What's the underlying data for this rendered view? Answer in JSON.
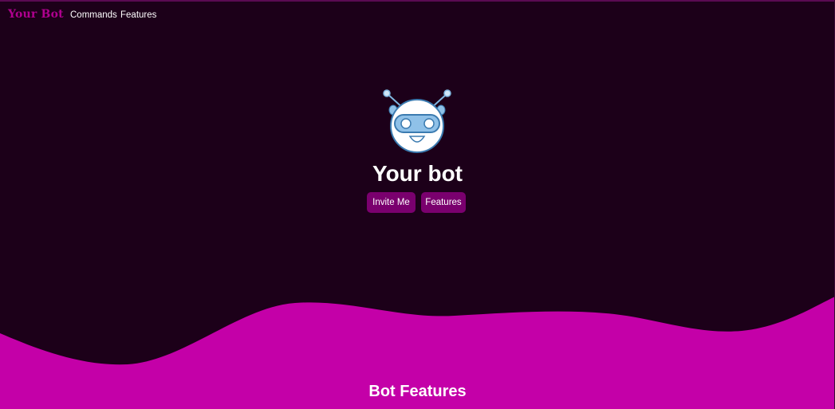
{
  "navbar": {
    "brand": "Your Bot",
    "links": [
      {
        "label": "Commands"
      },
      {
        "label": "Features"
      }
    ]
  },
  "hero": {
    "title": "Your bot",
    "logo_icon": "robot-icon",
    "buttons": {
      "invite_label": "Invite Me",
      "features_label": "Features"
    }
  },
  "features_section": {
    "title": "Bot Features"
  },
  "colors": {
    "background": "#1c0019",
    "accent": "#c400a8",
    "button": "#7a006e",
    "brand": "#b0008f",
    "robot_visor": "#8fc1e8"
  }
}
